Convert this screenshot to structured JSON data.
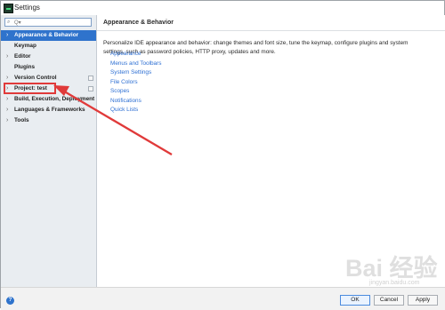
{
  "window": {
    "title": "Settings"
  },
  "sidebar": {
    "search": {
      "placeholder": "Q▾"
    },
    "items": [
      {
        "label": "Appearance & Behavior"
      },
      {
        "label": "Keymap"
      },
      {
        "label": "Editor"
      },
      {
        "label": "Plugins"
      },
      {
        "label": "Version Control"
      },
      {
        "label": "Project: test"
      },
      {
        "label": "Build, Execution, Deployment"
      },
      {
        "label": "Languages & Frameworks"
      },
      {
        "label": "Tools"
      }
    ]
  },
  "content": {
    "title": "Appearance & Behavior",
    "description": "Personalize IDE appearance and behavior: change themes and font size, tune the keymap, configure plugins and system settings, such as password policies, HTTP proxy, updates and more.",
    "links": [
      "Appearance",
      "Menus and Toolbars",
      "System Settings",
      "File Colors",
      "Scopes",
      "Notifications",
      "Quick Lists"
    ]
  },
  "footer": {
    "ok": "OK",
    "cancel": "Cancel",
    "apply": "Apply"
  },
  "watermark": {
    "text": "Bai 经验",
    "subtext": "jingyan.baidu.com"
  },
  "colors": {
    "selection": "#2f73cc",
    "link": "#2d6fd3",
    "annotation": "#e03a3a"
  }
}
